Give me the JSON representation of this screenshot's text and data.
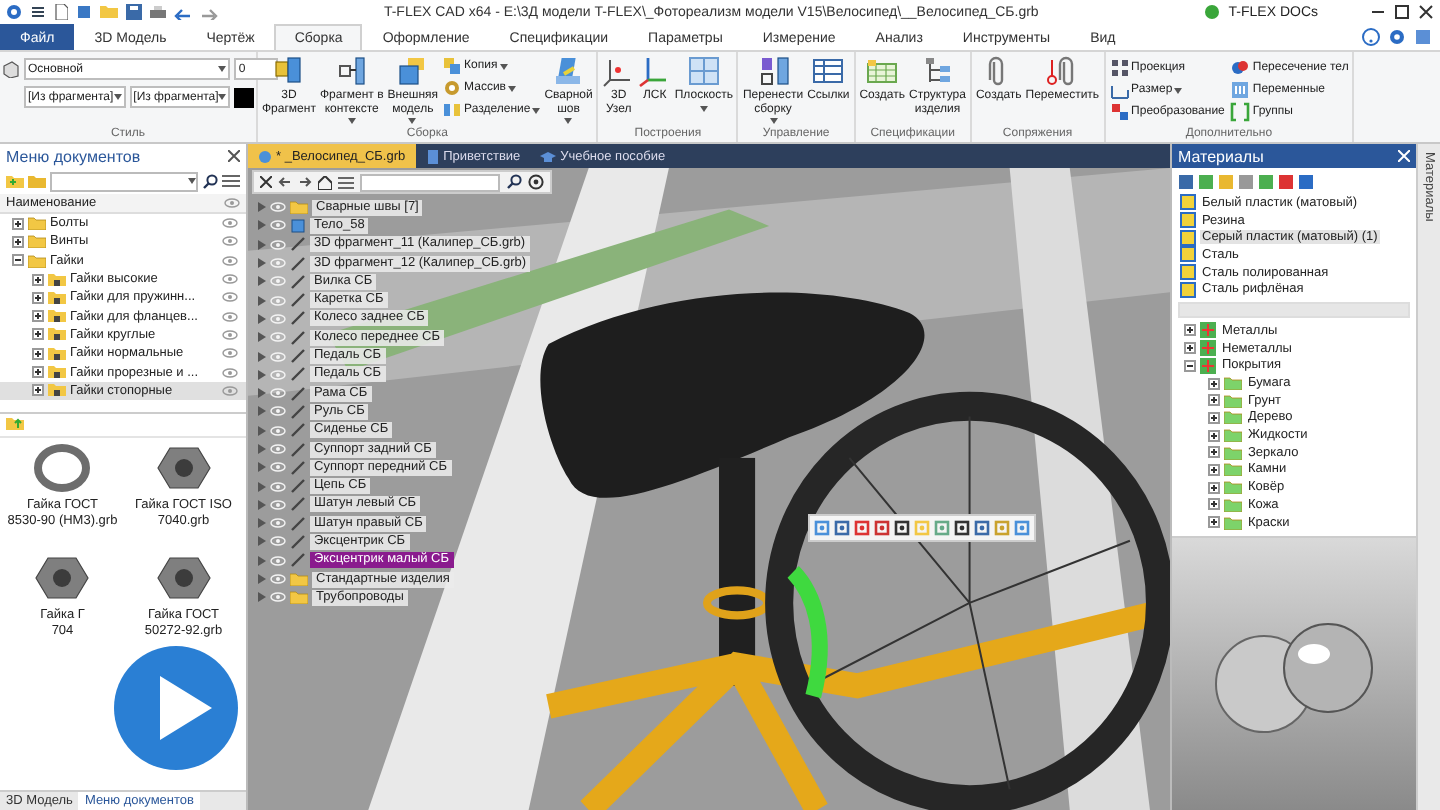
{
  "title_bar": {
    "title": "T-FLEX CAD x64 - E:\\3Д модели T-FLEX\\_Фотореализм модели V15\\Велосипед\\__Велосипед_СБ.grb",
    "docs": "T-FLEX DOCs"
  },
  "menu_tabs": [
    {
      "label": "Файл",
      "kind": "file",
      "selected": false
    },
    {
      "label": "3D Модель",
      "kind": "tab",
      "selected": false
    },
    {
      "label": "Чертёж",
      "kind": "tab",
      "selected": false
    },
    {
      "label": "Сборка",
      "kind": "tab",
      "selected": true
    },
    {
      "label": "Оформление",
      "kind": "tab",
      "selected": false
    },
    {
      "label": "Спецификации",
      "kind": "tab",
      "selected": false
    },
    {
      "label": "Параметры",
      "kind": "tab",
      "selected": false
    },
    {
      "label": "Измерение",
      "kind": "tab",
      "selected": false
    },
    {
      "label": "Анализ",
      "kind": "tab",
      "selected": false
    },
    {
      "label": "Инструменты",
      "kind": "tab",
      "selected": false
    },
    {
      "label": "Вид",
      "kind": "tab",
      "selected": false
    }
  ],
  "ribbon": [
    {
      "title": "Стиль",
      "kind": "style",
      "fields": [
        "Основной",
        "0",
        "[Из фрагмента]",
        "[Из фрагмента]"
      ]
    },
    {
      "title": "Сборка",
      "kind": "buttons",
      "items": [
        {
          "label": "3D\nФрагмент",
          "kind": "large",
          "menu": false
        },
        {
          "label": "Фрагмент в\nконтексте",
          "kind": "large",
          "menu": true
        },
        {
          "label": "Внешняя\nмодель",
          "kind": "large",
          "menu": true
        },
        {
          "label": "Копия",
          "kind": "small",
          "menu": true
        },
        {
          "label": "Массив",
          "kind": "small",
          "menu": true
        },
        {
          "label": "Разделение",
          "kind": "small",
          "menu": true
        },
        {
          "label": "Сварной\nшов",
          "kind": "large",
          "menu": true
        }
      ]
    },
    {
      "title": "Построения",
      "kind": "buttons",
      "items": [
        {
          "label": "3D\nУзел",
          "kind": "large",
          "menu": false
        },
        {
          "label": "ЛСК",
          "kind": "large",
          "menu": false
        },
        {
          "label": "Плоскость",
          "kind": "large",
          "menu": true
        }
      ]
    },
    {
      "title": "Управление",
      "kind": "buttons",
      "items": [
        {
          "label": "Перенести\nсборку",
          "kind": "large",
          "menu": true
        },
        {
          "label": "Ссылки",
          "kind": "large",
          "menu": false
        }
      ]
    },
    {
      "title": "Спецификации",
      "kind": "buttons",
      "items": [
        {
          "label": "Создать",
          "kind": "large",
          "menu": false
        },
        {
          "label": "Структура\nизделия",
          "kind": "large",
          "menu": false
        }
      ]
    },
    {
      "title": "Сопряжения",
      "kind": "buttons",
      "items": [
        {
          "label": "Создать",
          "kind": "large",
          "menu": false
        },
        {
          "label": "Переместить",
          "kind": "large",
          "menu": false
        }
      ]
    },
    {
      "title": "Дополнительно",
      "kind": "buttons",
      "items": [
        {
          "label": "Проекция",
          "kind": "small",
          "menu": false
        },
        {
          "label": "Размер",
          "kind": "small",
          "menu": true
        },
        {
          "label": "Преобразование",
          "kind": "small",
          "menu": false
        },
        {
          "label": "Пересечение тел",
          "kind": "small",
          "menu": false
        },
        {
          "label": "Переменные",
          "kind": "small",
          "menu": false
        },
        {
          "label": "Группы",
          "kind": "small",
          "menu": false
        }
      ]
    }
  ],
  "documents_panel": {
    "title": "Меню документов",
    "column": "Наименование",
    "tree": [
      {
        "label": "Болты",
        "expanded": false,
        "selected": false
      },
      {
        "label": "Винты",
        "expanded": false,
        "selected": false
      },
      {
        "label": "Гайки",
        "expanded": true,
        "selected": false,
        "children": [
          {
            "label": "Гайки высокие",
            "expanded": false,
            "selected": false
          },
          {
            "label": "Гайки для пружинн...",
            "expanded": false,
            "selected": false
          },
          {
            "label": "Гайки для фланцев...",
            "expanded": false,
            "selected": false
          },
          {
            "label": "Гайки круглые",
            "expanded": false,
            "selected": false
          },
          {
            "label": "Гайки нормальные",
            "expanded": false,
            "selected": false
          },
          {
            "label": "Гайки прорезные и ...",
            "expanded": false,
            "selected": false
          },
          {
            "label": "Гайки стопорные",
            "expanded": false,
            "selected": true
          }
        ]
      }
    ],
    "files": [
      {
        "label": "Гайка ГОСТ\n8530-90 (НМ3).grb",
        "kind": "ring"
      },
      {
        "label": "Гайка ГОСТ ISO\n7040.grb",
        "kind": "nut"
      },
      {
        "label": "Гайка Г\n704",
        "kind": "nut"
      },
      {
        "label": "Гайка ГОСТ\n50272-92.grb",
        "kind": "nut"
      }
    ],
    "tabs": [
      {
        "label": "3D Модель",
        "selected": false
      },
      {
        "label": "Меню документов",
        "selected": true
      }
    ]
  },
  "viewport": {
    "tabs": [
      {
        "label": "* _Велосипед_СБ.grb",
        "selected": true,
        "kind": "doc"
      },
      {
        "label": "Приветствие",
        "selected": false,
        "kind": "page"
      },
      {
        "label": "Учебное пособие",
        "selected": false,
        "kind": "tutorial"
      }
    ],
    "tree": [
      {
        "label": "Сварные швы [7]",
        "kind": "folder",
        "selected": false
      },
      {
        "label": "Тело_58",
        "kind": "body",
        "selected": false
      },
      {
        "label": "3D фрагмент_11 (Калипер_СБ.grb)",
        "kind": "part",
        "selected": false
      },
      {
        "label": "3D фрагмент_12 (Калипер_СБ.grb)",
        "kind": "part",
        "selected": false
      },
      {
        "label": "Вилка СБ",
        "kind": "part",
        "selected": false
      },
      {
        "label": "Каретка СБ",
        "kind": "part",
        "selected": false
      },
      {
        "label": "Колесо заднее СБ",
        "kind": "part",
        "selected": false
      },
      {
        "label": "Колесо переднее СБ",
        "kind": "part",
        "selected": false
      },
      {
        "label": "Педаль СБ",
        "kind": "part",
        "selected": false
      },
      {
        "label": "Педаль СБ",
        "kind": "part",
        "selected": false
      },
      {
        "label": "Рама СБ",
        "kind": "part",
        "selected": false
      },
      {
        "label": "Руль СБ",
        "kind": "part",
        "selected": false
      },
      {
        "label": "Сиденье СБ",
        "kind": "part",
        "selected": false
      },
      {
        "label": "Суппорт задний СБ",
        "kind": "part",
        "selected": false
      },
      {
        "label": "Суппорт передний СБ",
        "kind": "part",
        "selected": false
      },
      {
        "label": "Цепь СБ",
        "kind": "part",
        "selected": false
      },
      {
        "label": "Шатун левый СБ",
        "kind": "part",
        "selected": false
      },
      {
        "label": "Шатун правый СБ",
        "kind": "part",
        "selected": false
      },
      {
        "label": "Эксцентрик СБ",
        "kind": "part",
        "selected": false
      },
      {
        "label": "Эксцентрик малый СБ",
        "kind": "part",
        "selected": true
      },
      {
        "label": "Стандартные изделия",
        "kind": "folder",
        "selected": false
      },
      {
        "label": "Трубопроводы",
        "kind": "folder",
        "selected": false
      }
    ]
  },
  "materials_panel": {
    "title": "Материалы",
    "list": [
      {
        "label": "Белый пластик (матовый)",
        "selected": false
      },
      {
        "label": "Резина",
        "selected": false
      },
      {
        "label": "Серый пластик (матовый) (1)",
        "selected": true
      },
      {
        "label": "Сталь",
        "selected": false
      },
      {
        "label": "Сталь полированная",
        "selected": false
      },
      {
        "label": "Сталь рифлёная",
        "selected": false
      }
    ],
    "tree": [
      {
        "label": "Металлы",
        "expanded": false
      },
      {
        "label": "Неметаллы",
        "expanded": false
      },
      {
        "label": "Покрытия",
        "expanded": true,
        "children": [
          {
            "label": "Бумага",
            "expanded": false
          },
          {
            "label": "Грунт",
            "expanded": false
          },
          {
            "label": "Дерево",
            "expanded": false
          },
          {
            "label": "Жидкости",
            "expanded": false
          },
          {
            "label": "Зеркало",
            "expanded": false
          },
          {
            "label": "Камни",
            "expanded": false
          },
          {
            "label": "Ковёр",
            "expanded": false
          },
          {
            "label": "Кожа",
            "expanded": false
          },
          {
            "label": "Краски",
            "expanded": false
          }
        ]
      }
    ],
    "side_tab": "Материалы"
  }
}
